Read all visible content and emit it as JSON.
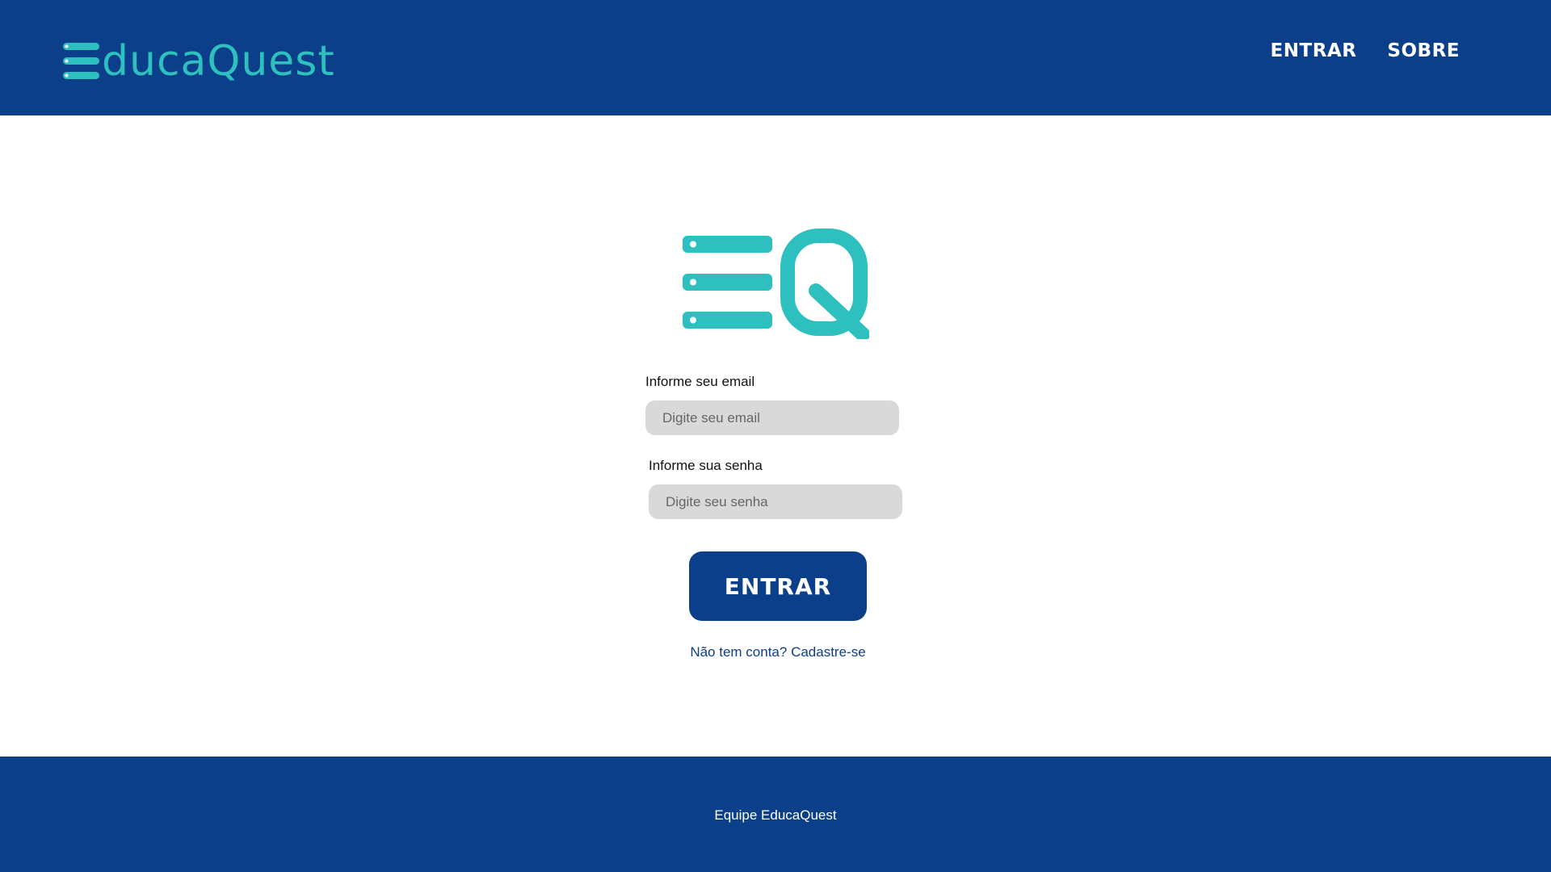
{
  "colors": {
    "primary": "#0b3f89",
    "accent": "#2ebfbf",
    "input_bg": "#d9d9d9",
    "background": "#ffffff"
  },
  "header": {
    "brand_name": "ducaQuest",
    "brand_icon": "menu-e-icon",
    "nav": [
      {
        "label": "ENTRAR"
      },
      {
        "label": "SOBRE"
      }
    ]
  },
  "main": {
    "logo_icon": "eq-logo-icon",
    "email": {
      "label": "Informe seu email",
      "placeholder": "Digite seu email",
      "value": ""
    },
    "password": {
      "label": "Informe sua senha",
      "placeholder": "Digite seu senha",
      "value": ""
    },
    "submit_label": "ENTRAR",
    "signup_link": "Não tem conta? Cadastre-se"
  },
  "footer": {
    "text": "Equipe EducaQuest"
  }
}
